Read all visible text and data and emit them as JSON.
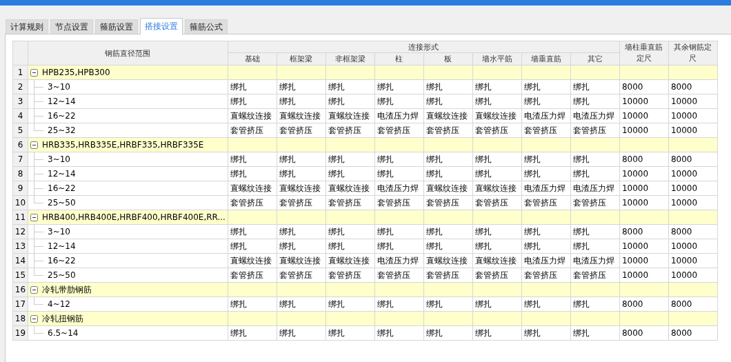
{
  "tabs": [
    {
      "label": "计算规则",
      "selected": false
    },
    {
      "label": "节点设置",
      "selected": false
    },
    {
      "label": "箍筋设置",
      "selected": false
    },
    {
      "label": "搭接设置",
      "selected": true
    },
    {
      "label": "箍筋公式",
      "selected": false
    }
  ],
  "table": {
    "range_heading": "钢筋直径范围",
    "group_heading": "连接形式",
    "group_columns": [
      "基础",
      "框架梁",
      "非框架梁",
      "柱",
      "板",
      "墙水平筋",
      "墙垂直筋",
      "其它"
    ],
    "extra_columns": [
      "墙柱垂直筋定尺",
      "其余钢筋定尺"
    ],
    "groups": [
      {
        "number": "1",
        "label": "HPB235,HPB300",
        "expanded": true,
        "children": [
          {
            "number": "2",
            "label": "3~10",
            "cells": [
              "绑扎",
              "绑扎",
              "绑扎",
              "绑扎",
              "绑扎",
              "绑扎",
              "绑扎",
              "绑扎",
              "8000",
              "8000"
            ]
          },
          {
            "number": "3",
            "label": "12~14",
            "cells": [
              "绑扎",
              "绑扎",
              "绑扎",
              "绑扎",
              "绑扎",
              "绑扎",
              "绑扎",
              "绑扎",
              "10000",
              "10000"
            ]
          },
          {
            "number": "4",
            "label": "16~22",
            "cells": [
              "直螺纹连接",
              "直螺纹连接",
              "直螺纹连接",
              "电渣压力焊",
              "直螺纹连接",
              "直螺纹连接",
              "电渣压力焊",
              "电渣压力焊",
              "10000",
              "10000"
            ]
          },
          {
            "number": "5",
            "label": "25~32",
            "cells": [
              "套管挤压",
              "套管挤压",
              "套管挤压",
              "套管挤压",
              "套管挤压",
              "套管挤压",
              "套管挤压",
              "套管挤压",
              "10000",
              "10000"
            ]
          }
        ]
      },
      {
        "number": "6",
        "label": "HRB335,HRB335E,HRBF335,HRBF335E",
        "expanded": true,
        "children": [
          {
            "number": "7",
            "label": "3~10",
            "cells": [
              "绑扎",
              "绑扎",
              "绑扎",
              "绑扎",
              "绑扎",
              "绑扎",
              "绑扎",
              "绑扎",
              "8000",
              "8000"
            ]
          },
          {
            "number": "8",
            "label": "12~14",
            "cells": [
              "绑扎",
              "绑扎",
              "绑扎",
              "绑扎",
              "绑扎",
              "绑扎",
              "绑扎",
              "绑扎",
              "10000",
              "10000"
            ]
          },
          {
            "number": "9",
            "label": "16~22",
            "cells": [
              "直螺纹连接",
              "直螺纹连接",
              "直螺纹连接",
              "电渣压力焊",
              "直螺纹连接",
              "直螺纹连接",
              "电渣压力焊",
              "电渣压力焊",
              "10000",
              "10000"
            ]
          },
          {
            "number": "10",
            "label": "25~50",
            "cells": [
              "套管挤压",
              "套管挤压",
              "套管挤压",
              "套管挤压",
              "套管挤压",
              "套管挤压",
              "套管挤压",
              "套管挤压",
              "10000",
              "10000"
            ]
          }
        ]
      },
      {
        "number": "11",
        "label": "HRB400,HRB400E,HRBF400,HRBF400E,RR...",
        "expanded": true,
        "children": [
          {
            "number": "12",
            "label": "3~10",
            "cells": [
              "绑扎",
              "绑扎",
              "绑扎",
              "绑扎",
              "绑扎",
              "绑扎",
              "绑扎",
              "绑扎",
              "8000",
              "8000"
            ]
          },
          {
            "number": "13",
            "label": "12~14",
            "cells": [
              "绑扎",
              "绑扎",
              "绑扎",
              "绑扎",
              "绑扎",
              "绑扎",
              "绑扎",
              "绑扎",
              "10000",
              "10000"
            ]
          },
          {
            "number": "14",
            "label": "16~22",
            "cells": [
              "直螺纹连接",
              "直螺纹连接",
              "直螺纹连接",
              "电渣压力焊",
              "直螺纹连接",
              "直螺纹连接",
              "电渣压力焊",
              "电渣压力焊",
              "10000",
              "10000"
            ]
          },
          {
            "number": "15",
            "label": "25~50",
            "cells": [
              "套管挤压",
              "套管挤压",
              "套管挤压",
              "套管挤压",
              "套管挤压",
              "套管挤压",
              "套管挤压",
              "套管挤压",
              "10000",
              "10000"
            ]
          }
        ]
      },
      {
        "number": "16",
        "label": "冷轧带肋钢筋",
        "expanded": true,
        "children": [
          {
            "number": "17",
            "label": "4~12",
            "cells": [
              "绑扎",
              "绑扎",
              "绑扎",
              "绑扎",
              "绑扎",
              "绑扎",
              "绑扎",
              "绑扎",
              "8000",
              "8000"
            ]
          }
        ]
      },
      {
        "number": "18",
        "label": "冷轧扭钢筋",
        "expanded": true,
        "children": [
          {
            "number": "19",
            "label": "6.5~14",
            "cells": [
              "绑扎",
              "绑扎",
              "绑扎",
              "绑扎",
              "绑扎",
              "绑扎",
              "绑扎",
              "绑扎",
              "8000",
              "8000"
            ]
          }
        ]
      }
    ]
  }
}
